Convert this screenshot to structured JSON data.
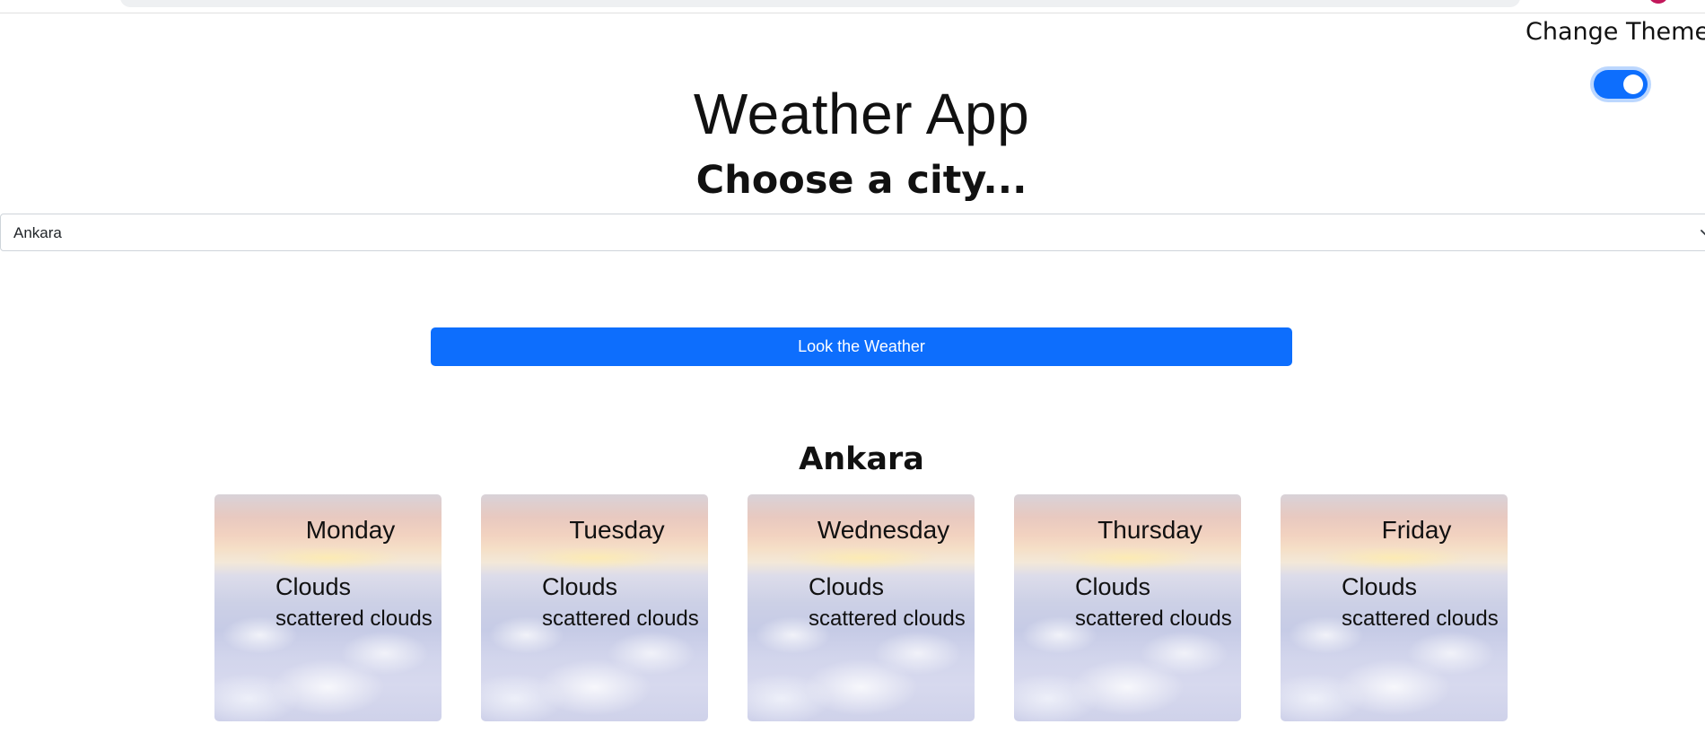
{
  "theme": {
    "label": "Change Theme",
    "toggle_on": true,
    "accent_color": "#0d6efd"
  },
  "header": {
    "title": "Weather App",
    "subtitle": "Choose a city..."
  },
  "city_select": {
    "selected": "Ankara",
    "icon": "chevron-down-icon"
  },
  "action": {
    "button_label": "Look the Weather"
  },
  "result": {
    "city": "Ankara",
    "days": [
      {
        "day": "Monday",
        "main": "Clouds",
        "description": "scattered clouds"
      },
      {
        "day": "Tuesday",
        "main": "Clouds",
        "description": "scattered clouds"
      },
      {
        "day": "Wednesday",
        "main": "Clouds",
        "description": "scattered clouds"
      },
      {
        "day": "Thursday",
        "main": "Clouds",
        "description": "scattered clouds"
      },
      {
        "day": "Friday",
        "main": "Clouds",
        "description": "scattered clouds"
      }
    ]
  }
}
